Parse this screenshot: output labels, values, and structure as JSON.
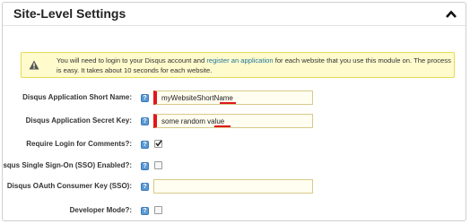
{
  "panel": {
    "title": "Site-Level Settings",
    "collapse_icon": "chevron-up-icon"
  },
  "notice": {
    "icon": "warning-icon",
    "text_before": "You will need to login to your Disqus account and ",
    "link_text": "register an application",
    "text_after": " for each website that you use this module on. The process is easy. It takes about 10 seconds for each website."
  },
  "fields": {
    "short_name": {
      "label": "Disqus Application Short Name:",
      "value": "myWebsiteShortName"
    },
    "secret_key": {
      "label": "Disqus Application Secret Key:",
      "value": "some random value"
    },
    "require_login": {
      "label": "Require Login for Comments?:",
      "checked": true
    },
    "sso_enabled": {
      "label": "Disqus Single Sign-On (SSO) Enabled?:",
      "checked": false
    },
    "oauth_key": {
      "label": "Disqus OAuth Consumer Key (SSO):",
      "value": ""
    },
    "developer_mode": {
      "label": "Developer Mode?:",
      "checked": false
    }
  },
  "help_icon": {
    "glyph": "?",
    "icon": "help-icon"
  },
  "colors": {
    "required_marker": "#e0171c",
    "notice_bg": "#fffbcc",
    "link": "#21759b",
    "help_icon": "#5b9bd5"
  }
}
